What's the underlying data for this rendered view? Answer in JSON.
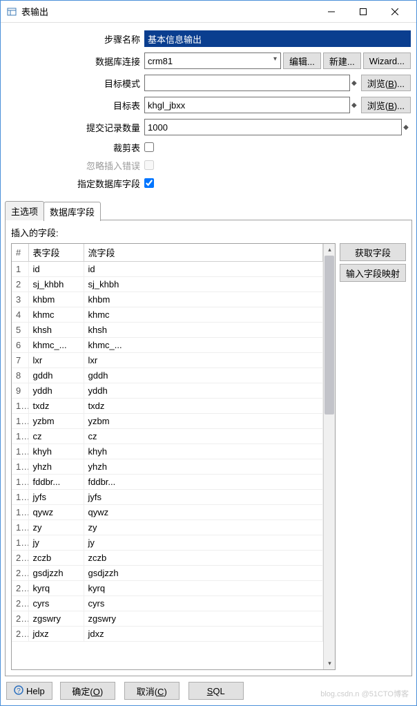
{
  "window": {
    "title": "表输出"
  },
  "form": {
    "step_name_label": "步骤名称",
    "step_name_value": "基本信息输出",
    "db_conn_label": "数据库连接",
    "db_conn_value": "crm81",
    "edit_btn": "编辑...",
    "new_btn": "新建...",
    "wizard_btn": "Wizard...",
    "target_schema_label": "目标模式",
    "target_schema_value": "",
    "browse1_btn": "浏览(B)...",
    "target_table_label": "目标表",
    "target_table_value": "khgl_jbxx",
    "browse2_btn": "浏览(B)...",
    "commit_size_label": "提交记录数量",
    "commit_size_value": "1000",
    "truncate_label": "裁剪表",
    "ignore_errors_label": "忽略插入错误",
    "specify_fields_label": "指定数据库字段"
  },
  "tabs": {
    "main": "主选项",
    "db_fields": "数据库字段"
  },
  "fields_section": {
    "label": "插入的字段:",
    "col_num": "#",
    "col_table_field": "表字段",
    "col_stream_field": "流字段",
    "rows": [
      {
        "n": "1",
        "a": "id",
        "b": "id"
      },
      {
        "n": "2",
        "a": "sj_khbh",
        "b": "sj_khbh"
      },
      {
        "n": "3",
        "a": "khbm",
        "b": "khbm"
      },
      {
        "n": "4",
        "a": "khmc",
        "b": "khmc"
      },
      {
        "n": "5",
        "a": "khsh",
        "b": "khsh"
      },
      {
        "n": "6",
        "a": "khmc_...",
        "b": "khmc_..."
      },
      {
        "n": "7",
        "a": "lxr",
        "b": "lxr"
      },
      {
        "n": "8",
        "a": "gddh",
        "b": "gddh"
      },
      {
        "n": "9",
        "a": "yddh",
        "b": "yddh"
      },
      {
        "n": "1..",
        "a": "txdz",
        "b": "txdz"
      },
      {
        "n": "1..",
        "a": "yzbm",
        "b": "yzbm"
      },
      {
        "n": "1..",
        "a": "cz",
        "b": "cz"
      },
      {
        "n": "1..",
        "a": "khyh",
        "b": "khyh"
      },
      {
        "n": "1..",
        "a": "yhzh",
        "b": "yhzh"
      },
      {
        "n": "1..",
        "a": "fddbr...",
        "b": "fddbr..."
      },
      {
        "n": "1..",
        "a": "jyfs",
        "b": "jyfs"
      },
      {
        "n": "1..",
        "a": "qywz",
        "b": "qywz"
      },
      {
        "n": "1..",
        "a": "zy",
        "b": "zy"
      },
      {
        "n": "1..",
        "a": "jy",
        "b": "jy"
      },
      {
        "n": "2..",
        "a": "zczb",
        "b": "zczb"
      },
      {
        "n": "2..",
        "a": "gsdjzzh",
        "b": "gsdjzzh"
      },
      {
        "n": "2..",
        "a": "kyrq",
        "b": "kyrq"
      },
      {
        "n": "2..",
        "a": "cyrs",
        "b": "cyrs"
      },
      {
        "n": "2..",
        "a": "zgswry",
        "b": "zgswry"
      },
      {
        "n": "2..",
        "a": "jdxz",
        "b": "jdxz"
      }
    ],
    "get_fields_btn": "获取字段",
    "input_mapping_btn": "输入字段映射"
  },
  "footer": {
    "help": "Help",
    "ok": "确定(O)",
    "cancel": "取消(C)",
    "sql": "SQL"
  },
  "watermark": "blog.csdn.n @51CTO博客"
}
